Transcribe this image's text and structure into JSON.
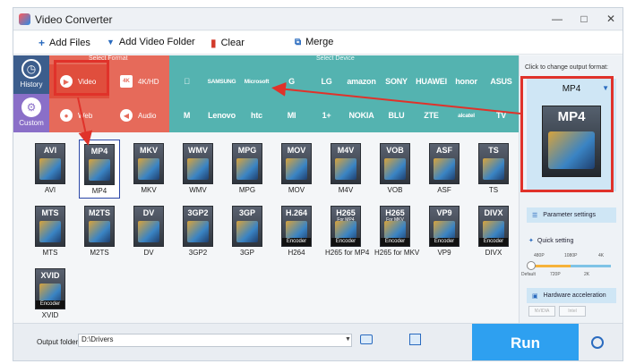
{
  "window": {
    "title": "Video Converter",
    "controls": [
      "—",
      "□",
      "✕"
    ]
  },
  "toolbar": {
    "add_files": "Add Files",
    "add_video_folder": "Add Video Folder",
    "clear": "Clear",
    "merge": "Merge"
  },
  "left_nav": [
    {
      "label": "History",
      "icon": "clock-icon"
    },
    {
      "label": "Custom",
      "icon": "gear-icon"
    }
  ],
  "select_format": {
    "header": "Select Format",
    "categories": [
      {
        "label": "Video",
        "icon": "play-icon",
        "active": true
      },
      {
        "label": "4K/HD",
        "icon": "4k-icon",
        "active": false
      },
      {
        "label": "Web",
        "icon": "chrome-icon",
        "active": false
      },
      {
        "label": "Audio",
        "icon": "speaker-icon",
        "active": false
      }
    ]
  },
  "select_device": {
    "header": "Select Device",
    "row1": [
      "",
      "SAMSUNG",
      "Microsoft",
      "G",
      "LG",
      "amazon",
      "SONY",
      "HUAWEI",
      "honor",
      "ASUS"
    ],
    "row2": [
      "M",
      "Lenovo",
      "htc",
      "MI",
      "1+",
      "NOKIA",
      "BLU",
      "ZTE",
      "alcatel",
      "TV"
    ]
  },
  "formats": {
    "row1": [
      {
        "name": "AVI",
        "label": "AVI"
      },
      {
        "name": "MP4",
        "label": "MP4",
        "selected": true
      },
      {
        "name": "MKV",
        "label": "MKV"
      },
      {
        "name": "WMV",
        "label": "WMV"
      },
      {
        "name": "MPG",
        "label": "MPG"
      },
      {
        "name": "MOV",
        "label": "MOV"
      },
      {
        "name": "M4V",
        "label": "M4V"
      },
      {
        "name": "VOB",
        "label": "VOB"
      },
      {
        "name": "ASF",
        "label": "ASF"
      },
      {
        "name": "TS",
        "label": "TS"
      }
    ],
    "row2": [
      {
        "name": "MTS",
        "label": "MTS"
      },
      {
        "name": "M2TS",
        "label": "M2TS"
      },
      {
        "name": "DV",
        "label": "DV"
      },
      {
        "name": "3GP2",
        "label": "3GP2"
      },
      {
        "name": "3GP",
        "label": "3GP"
      },
      {
        "name": "H.264",
        "label": "H264",
        "encoder": "Encoder"
      },
      {
        "name": "H265",
        "label": "H265 for MP4",
        "sub": "For MP4",
        "encoder": "Encoder"
      },
      {
        "name": "H265",
        "label": "H265 for MKV",
        "sub": "For MKV",
        "encoder": "Encoder"
      },
      {
        "name": "VP9",
        "label": "VP9",
        "encoder": "Encoder"
      },
      {
        "name": "DIVX",
        "label": "DIVX",
        "encoder": "Encoder"
      }
    ],
    "row3": [
      {
        "name": "XVID",
        "label": "XVID",
        "encoder": "Encoder"
      }
    ]
  },
  "right_panel": {
    "hint": "Click to change output format:",
    "output_format": "MP4",
    "parameter_settings": "Parameter settings",
    "quick_setting": "Quick setting",
    "ticks_top": [
      "480P",
      "1080P",
      "4K"
    ],
    "ticks_bottom": [
      "Default",
      "720P",
      "2K"
    ],
    "quick_setting_level": 0,
    "hardware_acceleration": "Hardware acceleration",
    "hw_chips": [
      "NVIDIA",
      "Intel"
    ]
  },
  "bottom": {
    "output_folder_label": "Output folder:",
    "output_folder_value": "D:\\Drivers",
    "run": "Run"
  },
  "colors": {
    "format_area": "#e66a5a",
    "device_area": "#54b3b0",
    "left_nav": "#3c5d8c",
    "run_button": "#2ea0f0",
    "highlight": "#e0322a"
  }
}
